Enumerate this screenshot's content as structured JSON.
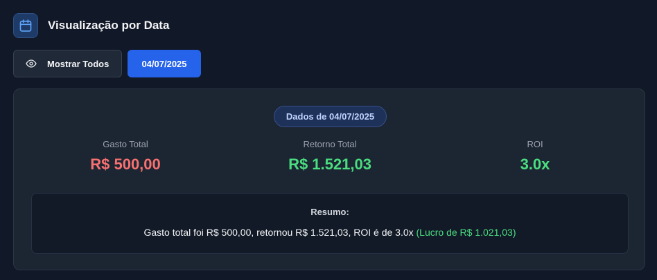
{
  "header": {
    "title": "Visualização por Data",
    "icon": "calendar-icon"
  },
  "buttons": {
    "show_all": "Mostrar Todos",
    "show_all_icon": "eye-icon",
    "date": "04/07/2025"
  },
  "card": {
    "badge": "Dados de 04/07/2025",
    "metrics": [
      {
        "label": "Gasto Total",
        "value": "R$ 500,00"
      },
      {
        "label": "Retorno Total",
        "value": "R$ 1.521,03"
      },
      {
        "label": "ROI",
        "value": "3.0x"
      }
    ],
    "summary": {
      "title": "Resumo:",
      "text": "Gasto total foi R$ 500,00, retornou R$ 1.521,03, ROI é de 3.0x",
      "profit": "(Lucro de R$ 1.021,03)"
    }
  },
  "colors": {
    "accent": "#2563eb",
    "negative": "#f87171",
    "positive": "#4ade80",
    "background": "#111827"
  }
}
